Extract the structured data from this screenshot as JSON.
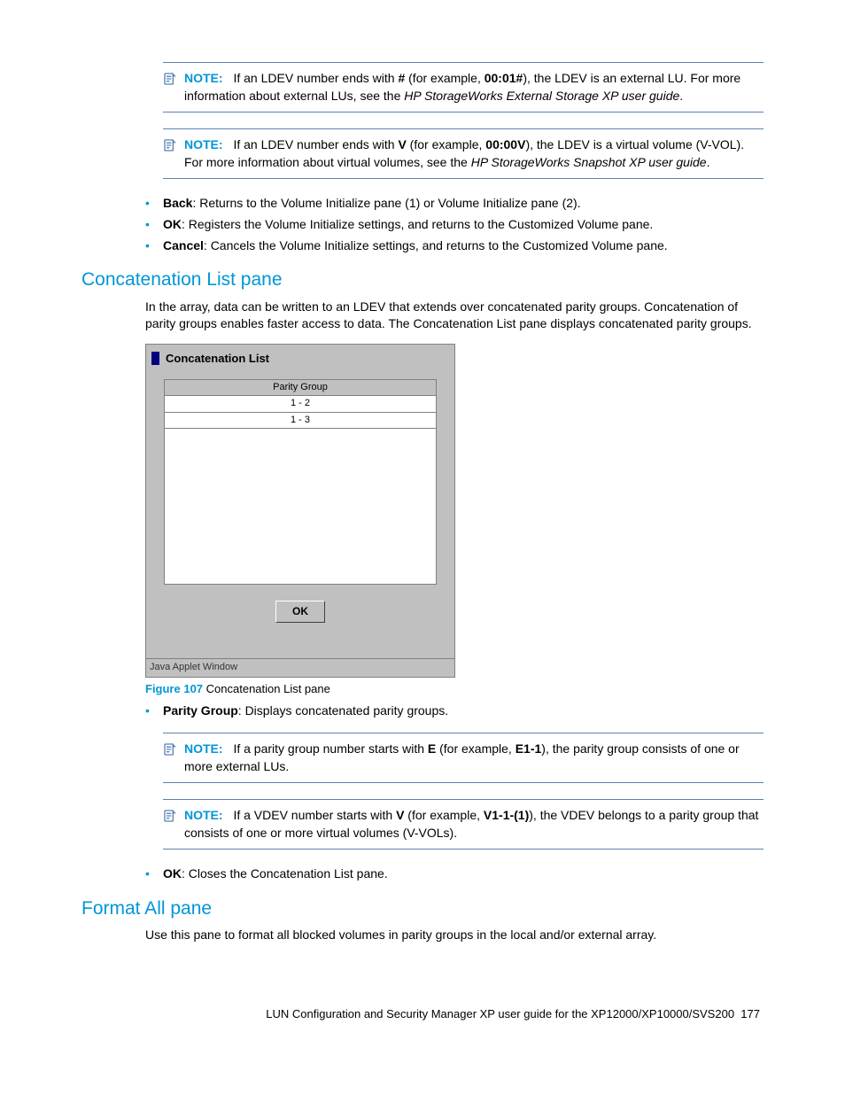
{
  "notes": {
    "n1": {
      "label": "NOTE:",
      "pre": "If an LDEV number ends with ",
      "em1": "#",
      "mid1": " (for example, ",
      "em2": "00:01#",
      "post1": "), the LDEV is an external LU. For more information about external LUs, see the ",
      "ref": "HP StorageWorks External Storage XP user guide",
      "post2": "."
    },
    "n2": {
      "label": "NOTE:",
      "pre": "If an LDEV number ends with ",
      "em1": "V",
      "mid1": " (for example, ",
      "em2": "00:00V",
      "post1": "), the LDEV is a virtual volume (V-VOL). For more information about virtual volumes, see the ",
      "ref": "HP StorageWorks Snapshot XP user guide",
      "post2": "."
    },
    "n3": {
      "label": "NOTE:",
      "pre": "If a parity group number starts with ",
      "em1": "E",
      "mid1": " (for example, ",
      "em2": "E1-1",
      "post1": "), the parity group consists of one or more external LUs."
    },
    "n4": {
      "label": "NOTE:",
      "pre": "If a VDEV number starts with ",
      "em1": "V",
      "mid1": " (for example, ",
      "em2": "V1-1-(1)",
      "post1": "), the VDEV belongs to a parity group that consists of one or more virtual volumes (V-VOLs)."
    }
  },
  "bullets1": {
    "b1": {
      "term": "Back",
      "desc": ": Returns to the Volume Initialize pane (1) or Volume Initialize pane (2)."
    },
    "b2": {
      "term": "OK",
      "desc": ": Registers the Volume Initialize settings, and returns to the Customized Volume pane."
    },
    "b3": {
      "term": "Cancel",
      "desc": ": Cancels the Volume Initialize settings, and returns to the Customized Volume pane."
    }
  },
  "h_concat": "Concatenation List pane",
  "p_concat": "In the array, data can be written to an LDEV that extends over concatenated parity groups. Concatenation of parity groups enables faster access to data. The Concatenation List pane displays concatenated parity groups.",
  "screenshot": {
    "title": "Concatenation List",
    "col": "Parity Group",
    "rows": [
      "1 - 2",
      "1 - 3"
    ],
    "ok": "OK",
    "status": "Java Applet Window"
  },
  "figure": {
    "label": "Figure 107",
    "caption": " Concatenation List pane"
  },
  "bullets2": {
    "b1": {
      "term": "Parity Group",
      "desc": ": Displays concatenated parity groups."
    },
    "b2": {
      "term": "OK",
      "desc": ": Closes the Concatenation List pane."
    }
  },
  "h_format": "Format All pane",
  "p_format": "Use this pane to format all blocked volumes in parity groups in the local and/or external array.",
  "footer": {
    "text": "LUN Configuration and Security Manager XP user guide for the XP12000/XP10000/SVS200",
    "page": "177"
  }
}
